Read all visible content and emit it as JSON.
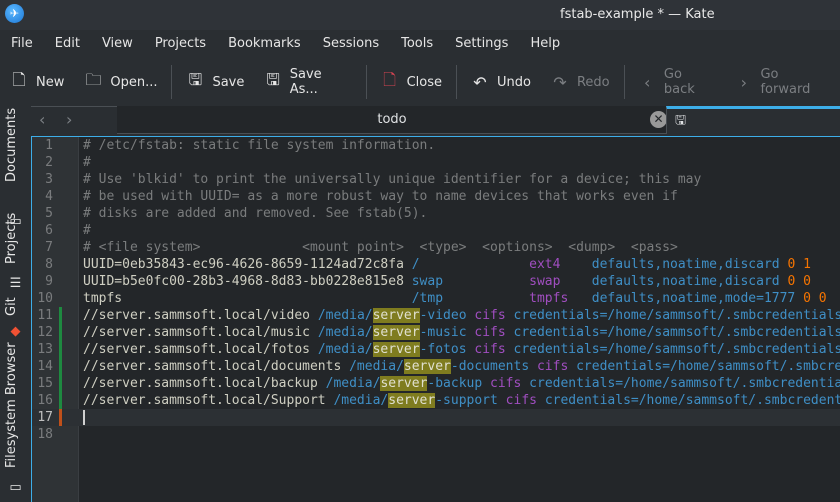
{
  "window": {
    "title": "fstab-example * — Kate",
    "app_icon": "kate-icon"
  },
  "menu": [
    "File",
    "Edit",
    "View",
    "Projects",
    "Bookmarks",
    "Sessions",
    "Tools",
    "Settings",
    "Help"
  ],
  "toolbar": {
    "new": "New",
    "open": "Open...",
    "save": "Save",
    "save_as": "Save As...",
    "close": "Close",
    "undo": "Undo",
    "redo": "Redo",
    "go_back": "Go back",
    "go_forward": "Go forward"
  },
  "tabs": {
    "active": "todo"
  },
  "sidebar": [
    "Documents",
    "Projects",
    "Git",
    "Filesystem Browser"
  ],
  "colors": {
    "accent": "#3daee9",
    "comment": "#7a7c7d",
    "blue": "#3f8fc6",
    "purple": "#a04ec0",
    "orange": "#f67400",
    "highlight": "#7f7c1f",
    "modified_saved": "#1e8a40",
    "modified_unsaved": "#c0501a"
  },
  "editor": {
    "lines": [
      {
        "n": "1",
        "seg": [
          [
            "# /etc/fstab: static file system information.",
            "c"
          ]
        ]
      },
      {
        "n": "2",
        "seg": [
          [
            "#",
            "c"
          ]
        ]
      },
      {
        "n": "3",
        "seg": [
          [
            "# Use 'blkid' to print the universally unique identifier for a device; this may",
            "c"
          ]
        ]
      },
      {
        "n": "4",
        "seg": [
          [
            "# be used with UUID= as a more robust way to name devices that works even if",
            "c"
          ]
        ]
      },
      {
        "n": "5",
        "seg": [
          [
            "# disks are added and removed. See fstab(5).",
            "c"
          ]
        ]
      },
      {
        "n": "6",
        "seg": [
          [
            "#",
            "c"
          ]
        ]
      },
      {
        "n": "7",
        "seg": [
          [
            "# <file system>             <mount point>  <type>  <options>  <dump>  <pass>",
            "c"
          ]
        ]
      },
      {
        "n": "8",
        "seg": [
          [
            "UUID=0eb35843-ec96-4626-8659-1124ad72c8fa ",
            "d"
          ],
          [
            "/              ",
            "b"
          ],
          [
            "ext4    ",
            "p"
          ],
          [
            "defaults,noatime,discard ",
            "b"
          ],
          [
            "0 1",
            "o"
          ]
        ]
      },
      {
        "n": "9",
        "seg": [
          [
            "UUID=b5e0fc00-28b3-4968-8d83-bb0228e815e8 ",
            "d"
          ],
          [
            "swap           ",
            "b"
          ],
          [
            "swap    ",
            "p"
          ],
          [
            "defaults,noatime,discard ",
            "b"
          ],
          [
            "0 0",
            "o"
          ]
        ]
      },
      {
        "n": "10",
        "seg": [
          [
            "tmpfs                                     ",
            "d"
          ],
          [
            "/tmp           ",
            "b"
          ],
          [
            "tmpfs   ",
            "p"
          ],
          [
            "defaults,noatime,mode=1777 ",
            "b"
          ],
          [
            "0 0",
            "o"
          ]
        ]
      },
      {
        "n": "11",
        "mark": "saved",
        "seg": [
          [
            "//server.sammsoft.local/video ",
            "d"
          ],
          [
            "/media/",
            "b"
          ],
          [
            "server",
            "h"
          ],
          [
            "-video ",
            "b"
          ],
          [
            "cifs ",
            "p"
          ],
          [
            "credentials=/home/sammsoft/.smbcredentials",
            "b"
          ]
        ]
      },
      {
        "n": "12",
        "mark": "saved",
        "seg": [
          [
            "//server.sammsoft.local/music ",
            "d"
          ],
          [
            "/media/",
            "b"
          ],
          [
            "server",
            "h"
          ],
          [
            "-music ",
            "b"
          ],
          [
            "cifs ",
            "p"
          ],
          [
            "credentials=/home/sammsoft/.smbcredentials",
            "b"
          ]
        ]
      },
      {
        "n": "13",
        "mark": "saved",
        "seg": [
          [
            "//server.sammsoft.local/fotos ",
            "d"
          ],
          [
            "/media/",
            "b"
          ],
          [
            "server",
            "h"
          ],
          [
            "-fotos ",
            "b"
          ],
          [
            "cifs ",
            "p"
          ],
          [
            "credentials=/home/sammsoft/.smbcredentials",
            "b"
          ]
        ]
      },
      {
        "n": "14",
        "mark": "saved",
        "seg": [
          [
            "//server.sammsoft.local/documents ",
            "d"
          ],
          [
            "/media/",
            "b"
          ],
          [
            "server",
            "h"
          ],
          [
            "-documents ",
            "b"
          ],
          [
            "cifs ",
            "p"
          ],
          [
            "credentials=/home/sammsoft/.smbcre",
            "b"
          ]
        ]
      },
      {
        "n": "15",
        "mark": "saved",
        "seg": [
          [
            "//server.sammsoft.local/backup ",
            "d"
          ],
          [
            "/media/",
            "b"
          ],
          [
            "server",
            "h"
          ],
          [
            "-backup ",
            "b"
          ],
          [
            "cifs ",
            "p"
          ],
          [
            "credentials=/home/sammsoft/.smbcredentia",
            "b"
          ]
        ]
      },
      {
        "n": "16",
        "mark": "saved",
        "seg": [
          [
            "//server.sammsoft.local/Support ",
            "d"
          ],
          [
            "/media/",
            "b"
          ],
          [
            "server",
            "h"
          ],
          [
            "-support ",
            "b"
          ],
          [
            "cifs ",
            "p"
          ],
          [
            "credentials=/home/sammsoft/.smbcredent",
            "b"
          ]
        ]
      },
      {
        "n": "17",
        "mark": "unsaved",
        "current": true,
        "seg": []
      },
      {
        "n": "18",
        "seg": []
      }
    ]
  }
}
